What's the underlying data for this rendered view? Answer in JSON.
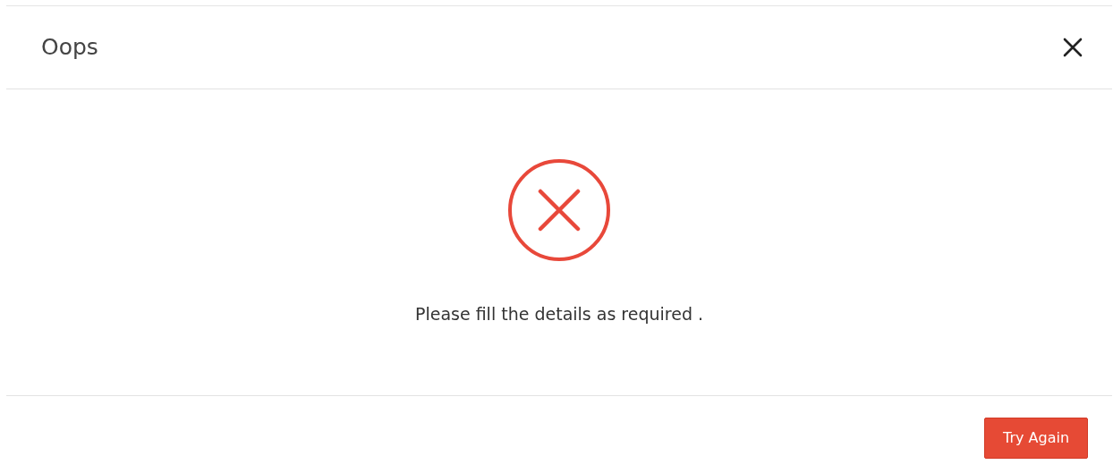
{
  "dialog": {
    "title": "Oops",
    "message": "Please fill the details as required .",
    "buttons": [
      {
        "label": "Try Again",
        "kind": "primary"
      }
    ]
  }
}
